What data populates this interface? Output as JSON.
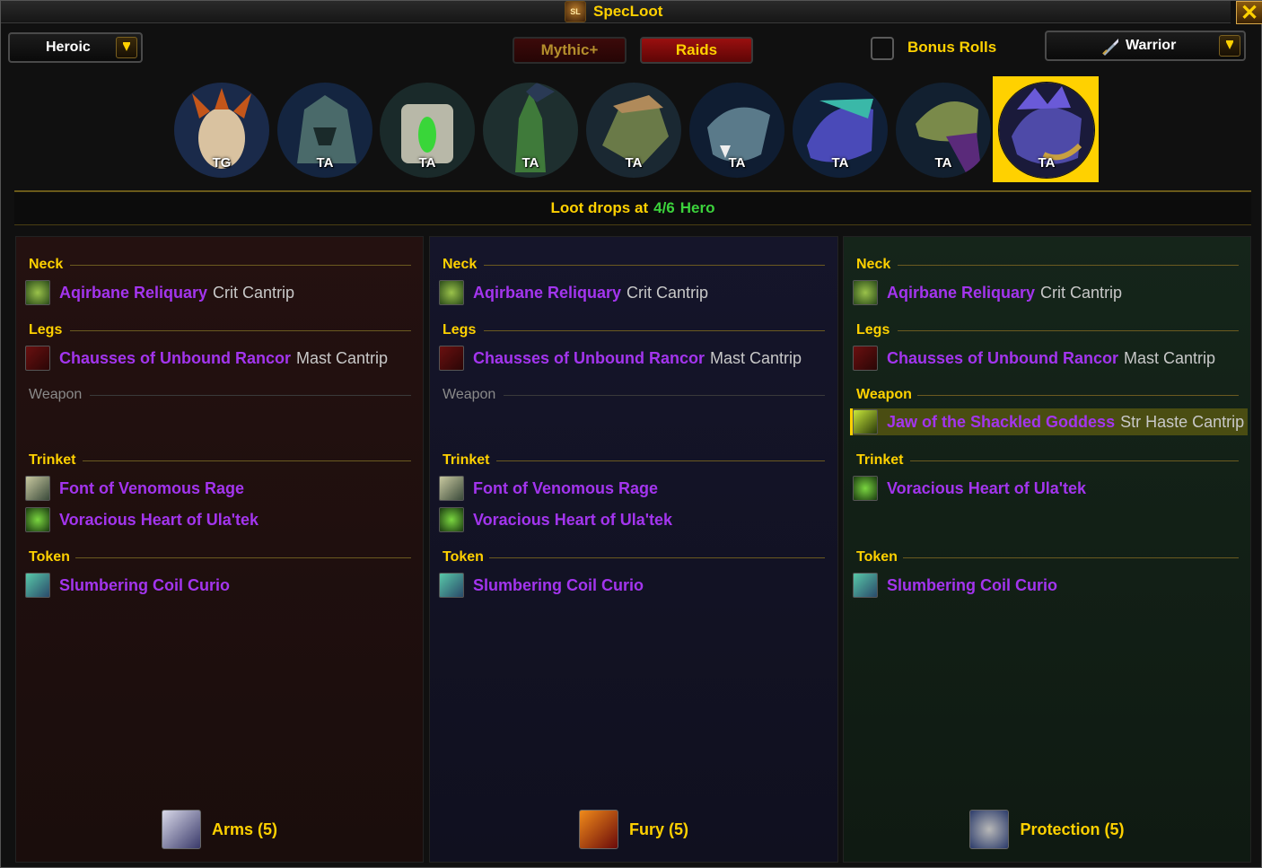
{
  "window": {
    "title": "SpecLoot",
    "logo_text": "SL",
    "close_symbol": "✕"
  },
  "difficulty_dropdown": {
    "label": "Heroic"
  },
  "tabs": {
    "mythic": "Mythic+",
    "raids": "Raids"
  },
  "bonus_rolls": {
    "label": "Bonus Rolls",
    "checked": false
  },
  "class_dropdown": {
    "label": "Warrior"
  },
  "bosses": [
    {
      "tag": "TG"
    },
    {
      "tag": "TA"
    },
    {
      "tag": "TA"
    },
    {
      "tag": "TA"
    },
    {
      "tag": "TA"
    },
    {
      "tag": "TA"
    },
    {
      "tag": "TA"
    },
    {
      "tag": "TA"
    },
    {
      "tag": "TA",
      "selected": true
    }
  ],
  "drops": {
    "prefix": "Loot drops at",
    "count": "4/6",
    "difficulty": "Hero"
  },
  "colors": {
    "epic": "#a335ee",
    "gold": "#ffd100",
    "green": "#3cd23c"
  },
  "panels": [
    {
      "spec": "Arms (5)",
      "slots": {
        "neck": {
          "label": "Neck",
          "items": [
            {
              "name": "Aqirbane Reliquary",
              "suffix": "Crit Cantrip"
            }
          ]
        },
        "legs": {
          "label": "Legs",
          "items": [
            {
              "name": "Chausses of Unbound Rancor",
              "suffix": "Mast Cantrip"
            }
          ]
        },
        "weapon": {
          "label": "Weapon",
          "items": []
        },
        "trinket": {
          "label": "Trinket",
          "items": [
            {
              "name": "Font of Venomous Rage"
            },
            {
              "name": "Voracious Heart of Ula'tek"
            }
          ]
        },
        "token": {
          "label": "Token",
          "items": [
            {
              "name": "Slumbering Coil Curio"
            }
          ]
        }
      }
    },
    {
      "spec": "Fury (5)",
      "slots": {
        "neck": {
          "label": "Neck",
          "items": [
            {
              "name": "Aqirbane Reliquary",
              "suffix": "Crit Cantrip"
            }
          ]
        },
        "legs": {
          "label": "Legs",
          "items": [
            {
              "name": "Chausses of Unbound Rancor",
              "suffix": "Mast Cantrip"
            }
          ]
        },
        "weapon": {
          "label": "Weapon",
          "items": []
        },
        "trinket": {
          "label": "Trinket",
          "items": [
            {
              "name": "Font of Venomous Rage"
            },
            {
              "name": "Voracious Heart of Ula'tek"
            }
          ]
        },
        "token": {
          "label": "Token",
          "items": [
            {
              "name": "Slumbering Coil Curio"
            }
          ]
        }
      }
    },
    {
      "spec": "Protection (5)",
      "slots": {
        "neck": {
          "label": "Neck",
          "items": [
            {
              "name": "Aqirbane Reliquary",
              "suffix": "Crit Cantrip"
            }
          ]
        },
        "legs": {
          "label": "Legs",
          "items": [
            {
              "name": "Chausses of Unbound Rancor",
              "suffix": "Mast Cantrip"
            }
          ]
        },
        "weapon": {
          "label": "Weapon",
          "items": [
            {
              "name": "Jaw of the Shackled Goddess",
              "suffix": "Str Haste Cantrip",
              "highlighted": true
            }
          ]
        },
        "trinket": {
          "label": "Trinket",
          "items": [
            {
              "name": "Voracious Heart of Ula'tek"
            }
          ]
        },
        "token": {
          "label": "Token",
          "items": [
            {
              "name": "Slumbering Coil Curio"
            }
          ]
        }
      }
    }
  ]
}
